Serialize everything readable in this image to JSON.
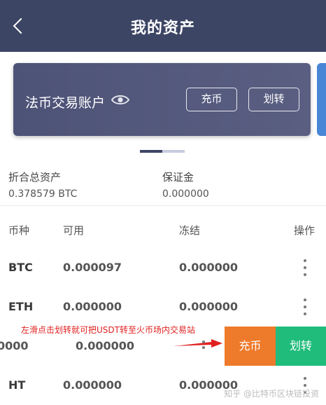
{
  "header": {
    "title": "我的资产"
  },
  "card": {
    "label": "法币交易账户",
    "deposit_label": "充币",
    "transfer_label": "划转"
  },
  "summary": {
    "total_label": "折合总资产",
    "total_value": "0.378579 BTC",
    "margin_label": "保证金",
    "margin_value": "0.000000"
  },
  "table": {
    "headers": [
      "币种",
      "可用",
      "冻结",
      "操作"
    ],
    "rows": [
      {
        "coin": "BTC",
        "available": "0.000097",
        "frozen": "0.000000"
      },
      {
        "coin": "ETH",
        "available": "0.000000",
        "frozen": "0.000000"
      },
      {
        "coin": "",
        "available_partial": "0000",
        "available": "0.000000",
        "frozen": ""
      },
      {
        "coin": "HT",
        "available": "0.000000",
        "frozen": "0.000000"
      }
    ]
  },
  "swipe_actions": {
    "deposit_label": "充币",
    "transfer_label": "划转"
  },
  "annotation": "左滑点击划转就可把USDT转至火币场内交易站",
  "watermark": "知乎 @比特币区块链投资",
  "colors": {
    "header_bg": "#3d4565",
    "card_bg": "#4d5377",
    "deposit_orange": "#ee7a2c",
    "transfer_green": "#1fbc7b",
    "annotation_red": "#e02020"
  },
  "icons": [
    "chevron-left-icon",
    "eye-icon",
    "more-vertical-icon",
    "arrow-icon"
  ]
}
